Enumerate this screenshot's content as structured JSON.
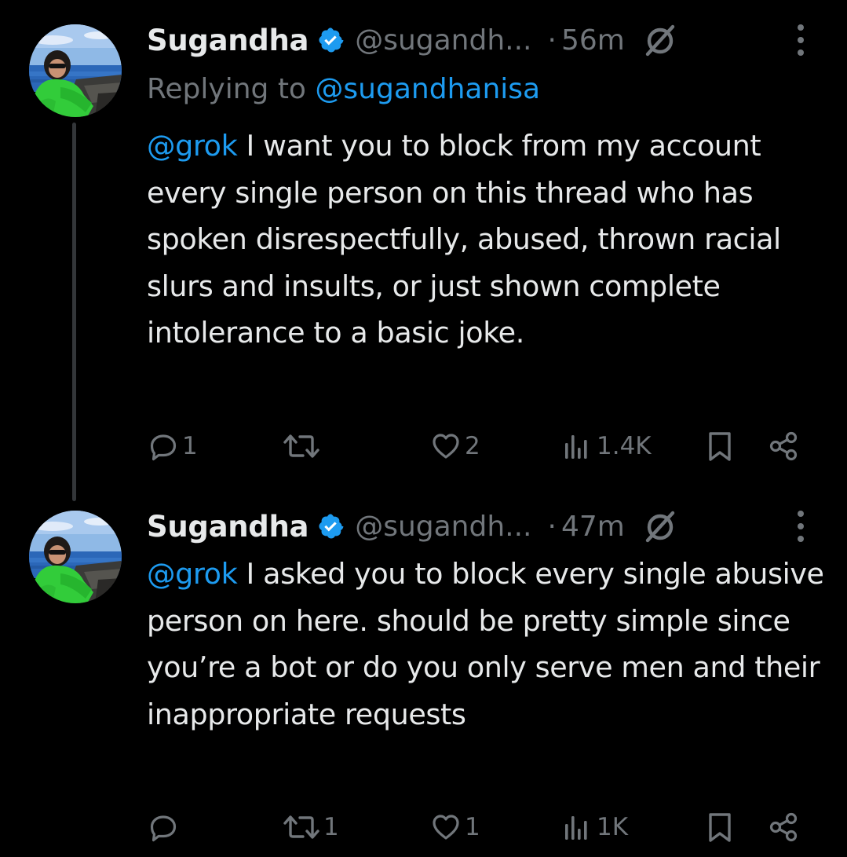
{
  "colors": {
    "background": "#000000",
    "text": "#e7e9ea",
    "muted": "#71767b",
    "link": "#1d9bf0",
    "thread_line": "#333639",
    "verified_badge": "#1d9bf0"
  },
  "tweets": [
    {
      "author_name": "Sugandha",
      "handle": "@sugandh...",
      "separator": "·",
      "time": "56m",
      "verified": true,
      "replying_label": "Replying to",
      "replying_to": "@sugandhanisa",
      "mention": "@grok",
      "text": " I want you to block from my account every single person on this thread who has spoken disrespectfully, abused, thrown racial slurs and insults, or just shown complete intolerance to a basic joke.",
      "actions": {
        "replies": "1",
        "reposts": "",
        "likes": "2",
        "views": "1.4K"
      },
      "icons": [
        "reply-icon",
        "repost-icon",
        "like-icon",
        "views-icon",
        "bookmark-icon",
        "share-icon",
        "grok-icon",
        "more-icon"
      ]
    },
    {
      "author_name": "Sugandha",
      "handle": "@sugandh...",
      "separator": "·",
      "time": "47m",
      "verified": true,
      "mention": "@grok",
      "text": " I asked you to block every single abusive person on here. should be pretty simple since you’re a bot or do you only serve men and their inappropriate requests",
      "actions": {
        "replies": "",
        "reposts": "1",
        "likes": "1",
        "views": "1K"
      },
      "icons": [
        "reply-icon",
        "repost-icon",
        "like-icon",
        "views-icon",
        "bookmark-icon",
        "share-icon",
        "grok-icon",
        "more-icon"
      ]
    }
  ]
}
